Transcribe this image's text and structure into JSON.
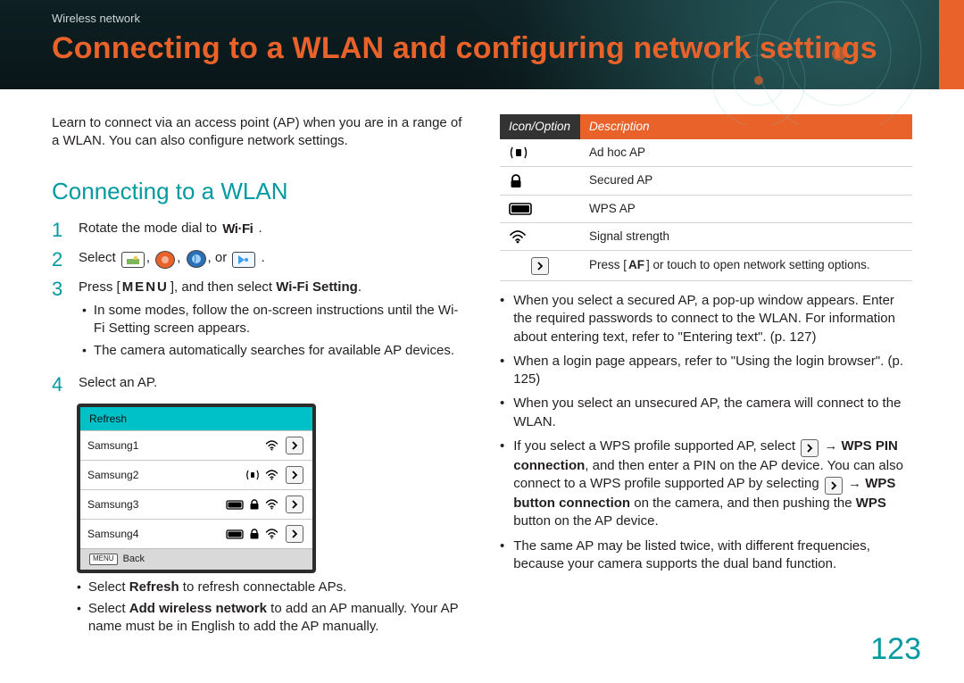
{
  "header": {
    "breadcrumb": "Wireless network",
    "title": "Connecting to a WLAN and configuring network settings"
  },
  "left": {
    "intro": "Learn to connect via an access point (AP) when you are in a range of a WLAN. You can also configure network settings.",
    "section_title": "Connecting to a WLAN",
    "step1": {
      "num": "1",
      "pre": "Rotate the mode dial to ",
      "wifi": "Wi·Fi",
      "post": "."
    },
    "step2": {
      "num": "2",
      "pre": "Select ",
      "post": "."
    },
    "step3": {
      "num": "3",
      "pre": "Press [",
      "menu": "MENU",
      "mid": "], and then select ",
      "bold": "Wi-Fi Setting",
      "post": ".",
      "sub1": "In some modes, follow the on-screen instructions until the Wi-Fi Setting screen appears.",
      "sub2": "The camera automatically searches for available AP devices."
    },
    "step4": {
      "num": "4",
      "text": "Select an AP.",
      "widget": {
        "header": "Refresh",
        "rows": [
          {
            "name": "Samsung1",
            "adhoc": false,
            "wps": false,
            "lock": false,
            "signal": true,
            "more": true
          },
          {
            "name": "Samsung2",
            "adhoc": true,
            "wps": false,
            "lock": false,
            "signal": true,
            "more": true
          },
          {
            "name": "Samsung3",
            "adhoc": false,
            "wps": true,
            "lock": true,
            "signal": true,
            "more": true
          },
          {
            "name": "Samsung4",
            "adhoc": false,
            "wps": true,
            "lock": true,
            "signal": true,
            "more": true
          }
        ],
        "footer_label": "MENU",
        "footer_text": "Back"
      },
      "sub1_pre": "Select ",
      "sub1_b": "Refresh",
      "sub1_post": " to refresh connectable APs.",
      "sub2_pre": "Select ",
      "sub2_b": "Add wireless network",
      "sub2_post": " to add an AP manually. Your AP name must be in English to add the AP manually."
    }
  },
  "right": {
    "th1": "Icon/Option",
    "th2": "Description",
    "rows": {
      "adhoc": "Ad hoc AP",
      "lock": "Secured AP",
      "wps": "WPS AP",
      "signal": "Signal strength",
      "more_pre": "Press [",
      "more_af": "AF",
      "more_post": "] or touch to open network setting options."
    },
    "b1": "When you select a secured AP, a pop-up window appears. Enter the required passwords to connect to the WLAN. For information about entering text, refer to \"Entering text\". (p. 127)",
    "b2": "When a login page appears, refer to \"Using the login browser\". (p. 125)",
    "b3": "When you select an unsecured AP, the camera will connect to the WLAN.",
    "b4": {
      "pre": "If you select a WPS profile supported AP, select ",
      "arrow1": "›",
      "mid1": " → ",
      "bold1": "WPS PIN connection",
      "mid2": ", and then enter a PIN on the AP device. You can also connect to a WPS profile supported AP by selecting ",
      "arrow2": "›",
      "mid3": " → ",
      "bold2": "WPS button connection",
      "mid4": " on the camera, and then pushing the ",
      "bold3": "WPS",
      "post": " button on the AP device."
    },
    "b5": "The same AP may be listed twice, with different frequencies, because your camera supports the dual band function."
  },
  "page_number": "123"
}
